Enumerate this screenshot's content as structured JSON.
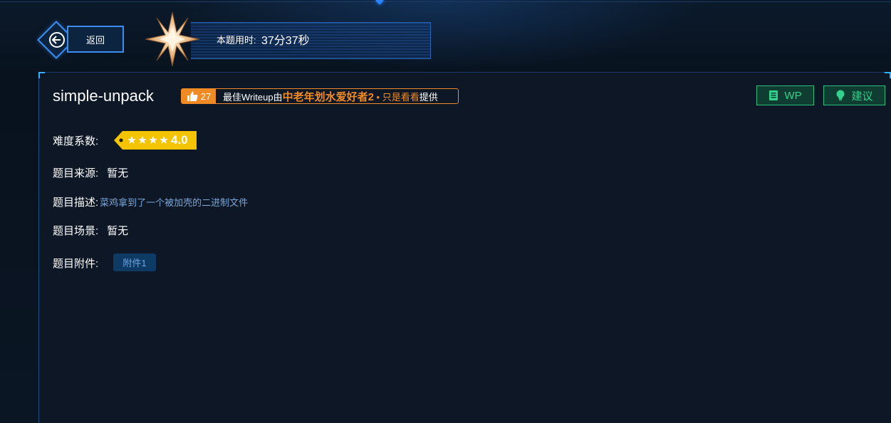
{
  "back": {
    "label": "返回"
  },
  "timer": {
    "label": "本题用时:",
    "value": "37分37秒"
  },
  "challenge": {
    "title": "simple-unpack",
    "writeup": {
      "likes": "27",
      "prefix": "最佳Writeup由",
      "author": "中老年划水爱好者2",
      "dot": "•",
      "note": "只是看看",
      "suffix": "提供"
    },
    "difficulty": {
      "label": "难度系数:",
      "stars": 4,
      "value": "4.0"
    },
    "source": {
      "label": "题目来源:",
      "value": "暂无"
    },
    "description": {
      "label": "题目描述:",
      "value": "菜鸡拿到了一个被加壳的二进制文件"
    },
    "scene": {
      "label": "题目场景:",
      "value": "暂无"
    },
    "attachments": {
      "label": "题目附件:",
      "items": [
        "附件1"
      ]
    }
  },
  "actions": {
    "wp_label": "WP",
    "suggest_label": "建议"
  },
  "colors": {
    "accent_orange": "#f08a24",
    "accent_green": "#33d18b",
    "accent_blue": "#3d8df0",
    "star_gold": "#f5c400"
  },
  "icons": [
    "arrow-left-icon",
    "star-badge-icon",
    "thumbs-up-icon",
    "book-icon",
    "lightbulb-icon",
    "star-icon"
  ]
}
